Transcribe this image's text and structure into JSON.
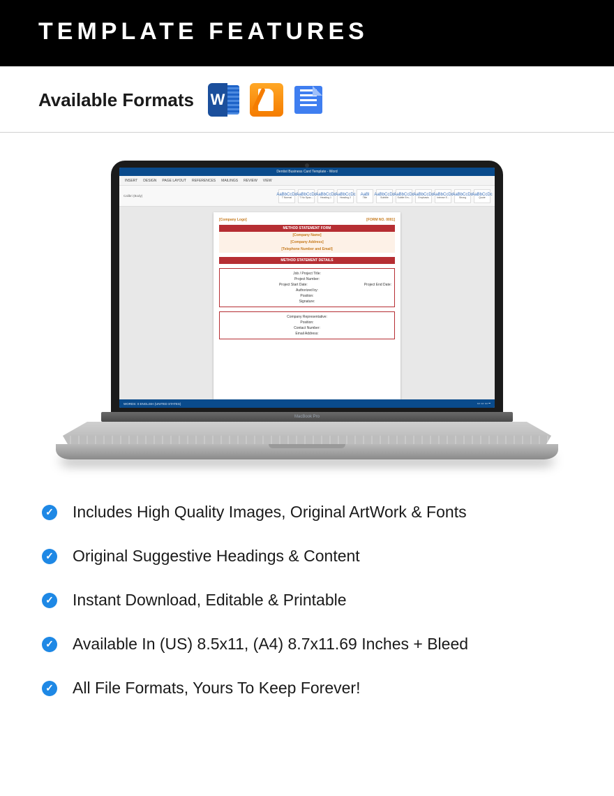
{
  "header": {
    "title": "TEMPLATE FEATURES"
  },
  "formats": {
    "label": "Available Formats",
    "icons": [
      "word-icon",
      "pages-icon",
      "google-docs-icon"
    ]
  },
  "mockup": {
    "app_title": "Dentist Business Card Template - Word",
    "tabs": [
      "INSERT",
      "DESIGN",
      "PAGE LAYOUT",
      "REFERENCES",
      "MAILINGS",
      "REVIEW",
      "VIEW"
    ],
    "font_label": "Calibri (Body)",
    "style_labels": [
      "T Normal",
      "T No Spac...",
      "Heading 1",
      "Heading 2",
      "Title",
      "Subtitle",
      "Subtle Em...",
      "Emphasis",
      "Intense E...",
      "Strong",
      "Quote"
    ],
    "styles_aa": "AaBbCcDc",
    "styles_aa_big": "AaBl",
    "status_left": "WORDS: 0    ENGLISH (UNITED STATES)",
    "hinge_label": "MacBook Pro",
    "doc": {
      "logo": "[Company Logo]",
      "form_no": "[FORM NO. 0001]",
      "header1": "METHOD STATEMENT FORM",
      "line1": "[Company Name]",
      "line2": "[Company Address]",
      "line3": "[Telephone Number and Email]",
      "header2": "METHOD STATEMENT DETAILS",
      "sec1": {
        "r1": "Job / Project Title:",
        "r2": "Project Number:",
        "r3l": "Project Start Date:",
        "r3r": "Project End Date:",
        "r4": "Authorized by:",
        "r5": "Position:",
        "r6": "Signature:"
      },
      "sec2": {
        "r1": "Company Representative:",
        "r2": "Position:",
        "r3": "Contact Number:",
        "r4": "Email Address:"
      }
    }
  },
  "features": [
    "Includes High Quality Images, Original ArtWork & Fonts",
    "Original Suggestive Headings & Content",
    "Instant Download, Editable & Printable",
    "Available In (US) 8.5x11, (A4) 8.7x11.69 Inches + Bleed",
    "All File Formats, Yours To Keep Forever!"
  ]
}
